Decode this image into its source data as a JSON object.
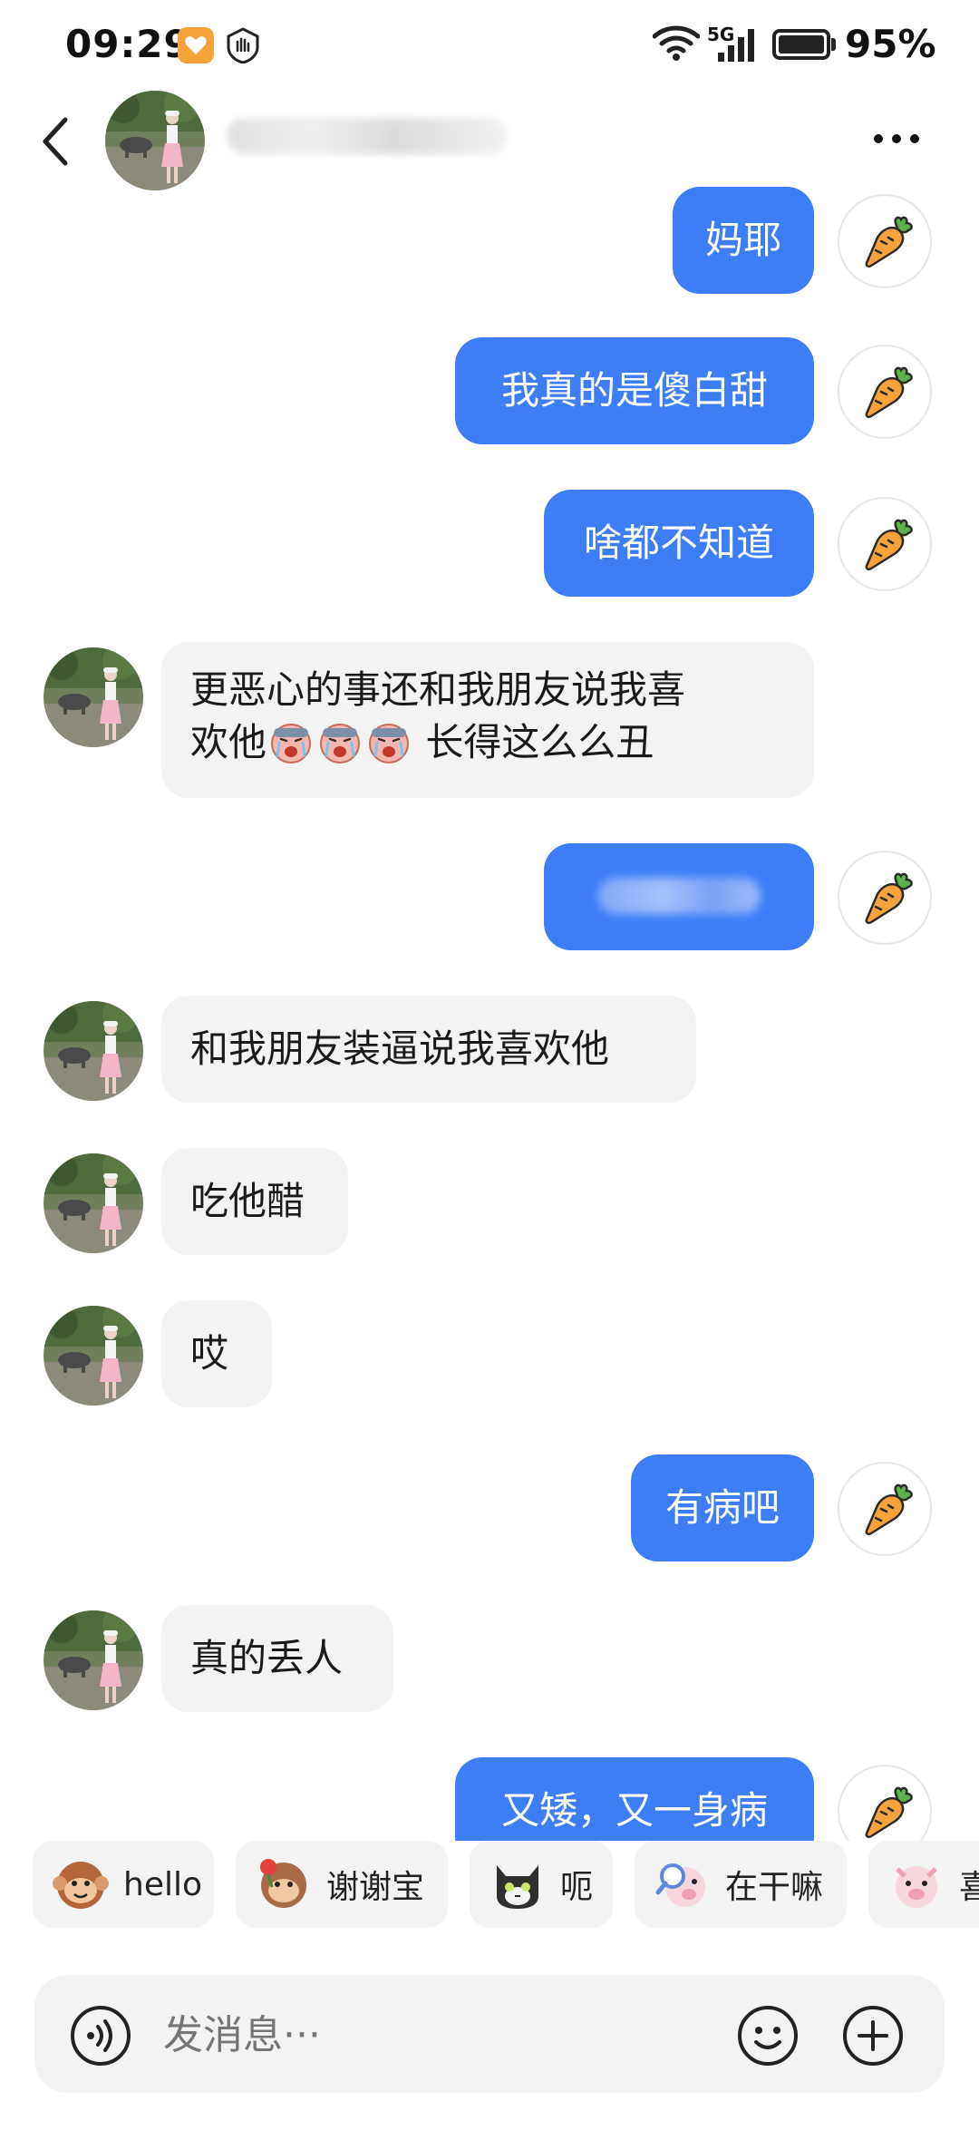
{
  "status_bar": {
    "time": "09:29",
    "network": "5G",
    "battery": "95%"
  },
  "header": {
    "back_icon": "chevron-left-icon",
    "more_icon": "more-horizontal-icon"
  },
  "messages": [
    {
      "side": "out",
      "text": "妈耶"
    },
    {
      "side": "out",
      "text": "我真的是傻白甜"
    },
    {
      "side": "out",
      "text": "啥都不知道"
    },
    {
      "side": "in",
      "line1": "更恶心的事还和我朋友说我喜",
      "line2_prefix": "欢他",
      "line2_suffix": "长得这么么丑"
    },
    {
      "side": "out",
      "text": ""
    },
    {
      "side": "in",
      "text": "和我朋友装逼说我喜欢他"
    },
    {
      "side": "in",
      "text": "吃他醋"
    },
    {
      "side": "in",
      "text": "哎"
    },
    {
      "side": "out",
      "text": "有病吧"
    },
    {
      "side": "in",
      "text": "真的丢人"
    },
    {
      "side": "out",
      "text": "又矮，又一身病"
    }
  ],
  "quick_replies": [
    {
      "label": "hello"
    },
    {
      "label": "谢谢宝"
    },
    {
      "label": "呃"
    },
    {
      "label": "在干嘛"
    },
    {
      "label": "喜"
    }
  ],
  "input": {
    "placeholder": "发消息···"
  },
  "colors": {
    "outgoing_bubble": "#3d7ef7",
    "incoming_bubble": "#f3f3f3",
    "status_app_badge": "#f5a23a"
  }
}
